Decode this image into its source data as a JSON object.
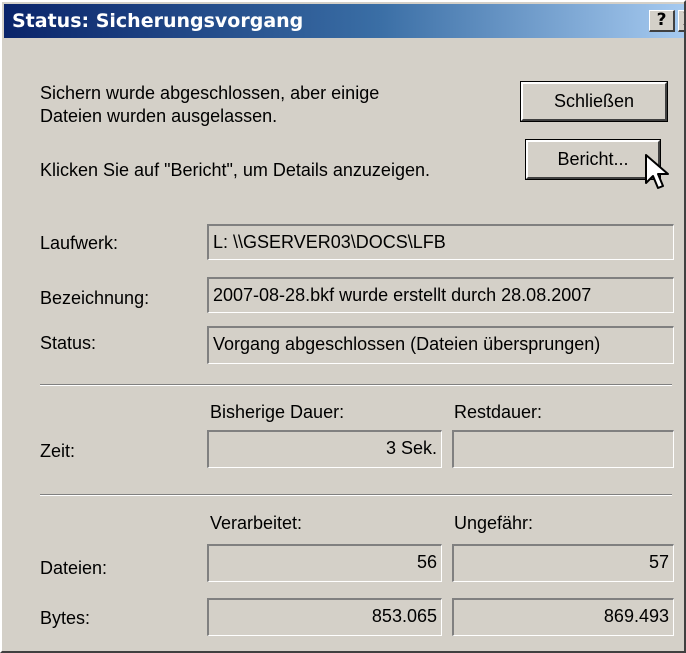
{
  "window": {
    "title": "Status: Sicherungsvorgang",
    "help_label": "?",
    "close_label": "X"
  },
  "message": {
    "line1": "Sichern wurde abgeschlossen, aber einige",
    "line2": "Dateien wurden ausgelassen.",
    "line3": "Klicken Sie auf \"Bericht\", um Details anzuzeigen."
  },
  "buttons": {
    "close_label": "Schließen",
    "report_label": "Bericht..."
  },
  "info": {
    "drive_label": "Laufwerk:",
    "drive_value": "L: \\\\GSERVER03\\DOCS\\LFB",
    "name_label": "Bezeichnung:",
    "name_value": "2007-08-28.bkf wurde erstellt durch 28.08.2007",
    "status_label": "Status:",
    "status_value": "Vorgang abgeschlossen (Dateien übersprungen)"
  },
  "time": {
    "row_label": "Zeit:",
    "elapsed_header": "Bisherige Dauer:",
    "remaining_header": "Restdauer:",
    "elapsed_value": "3 Sek.",
    "remaining_value": ""
  },
  "progress": {
    "processed_header": "Verarbeitet:",
    "estimated_header": "Ungefähr:",
    "files_label": "Dateien:",
    "files_processed": "56",
    "files_estimated": "57",
    "bytes_label": "Bytes:",
    "bytes_processed": "853.065",
    "bytes_estimated": "869.493"
  },
  "icons": {
    "cursor": "mouse-pointer-icon"
  }
}
